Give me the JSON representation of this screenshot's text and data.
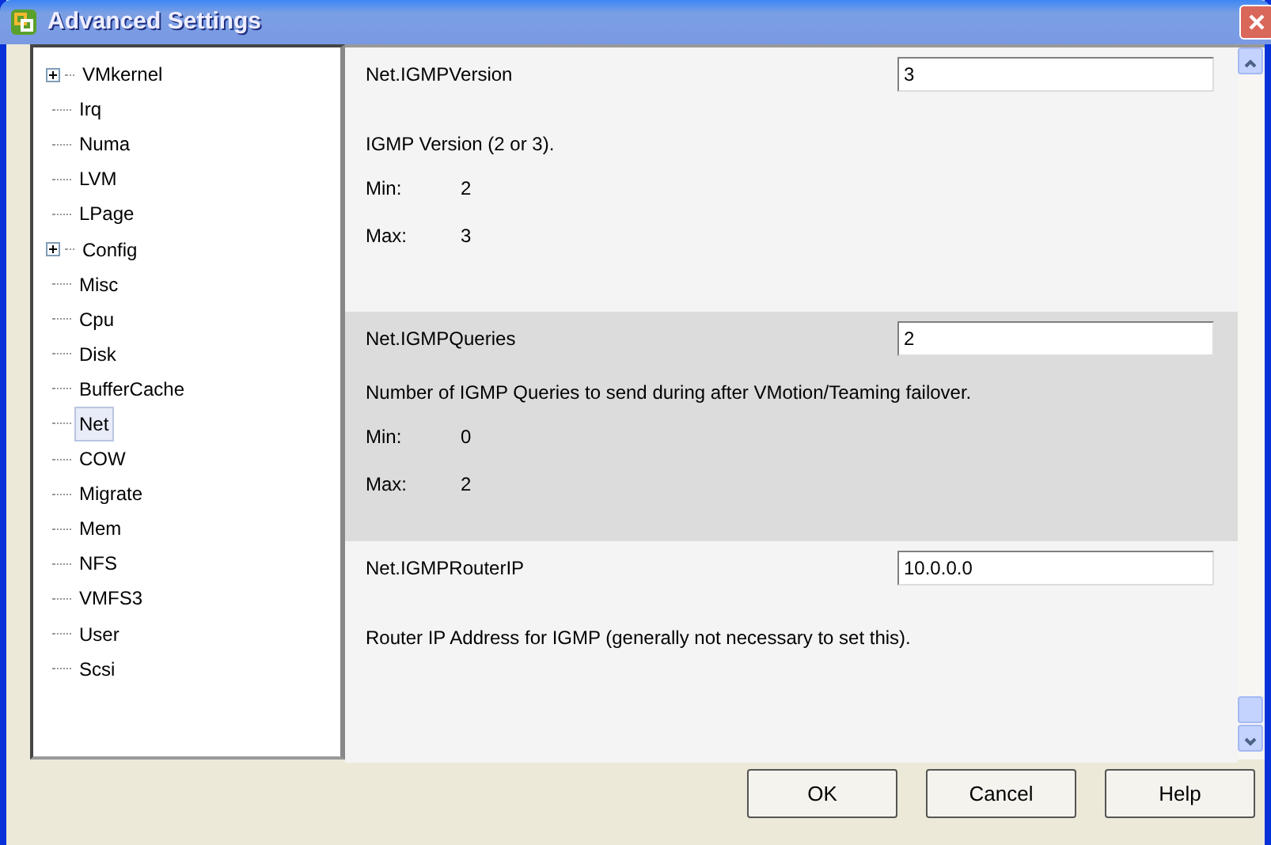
{
  "window": {
    "title": "Advanced Settings"
  },
  "tree": {
    "items": [
      {
        "label": "VMkernel",
        "kind": "group",
        "selected": false
      },
      {
        "label": "Irq",
        "kind": "leaf",
        "selected": false
      },
      {
        "label": "Numa",
        "kind": "leaf",
        "selected": false
      },
      {
        "label": "LVM",
        "kind": "leaf",
        "selected": false
      },
      {
        "label": "LPage",
        "kind": "leaf",
        "selected": false
      },
      {
        "label": "Config",
        "kind": "group",
        "selected": false
      },
      {
        "label": "Misc",
        "kind": "leaf",
        "selected": false
      },
      {
        "label": "Cpu",
        "kind": "leaf",
        "selected": false
      },
      {
        "label": "Disk",
        "kind": "leaf",
        "selected": false
      },
      {
        "label": "BufferCache",
        "kind": "leaf",
        "selected": false
      },
      {
        "label": "Net",
        "kind": "leaf",
        "selected": true
      },
      {
        "label": "COW",
        "kind": "leaf",
        "selected": false
      },
      {
        "label": "Migrate",
        "kind": "leaf",
        "selected": false
      },
      {
        "label": "Mem",
        "kind": "leaf",
        "selected": false
      },
      {
        "label": "NFS",
        "kind": "leaf",
        "selected": false
      },
      {
        "label": "VMFS3",
        "kind": "leaf",
        "selected": false
      },
      {
        "label": "User",
        "kind": "leaf",
        "selected": false
      },
      {
        "label": "Scsi",
        "kind": "leaf",
        "selected": false
      }
    ]
  },
  "settings": [
    {
      "name": "Net.IGMPVersion",
      "value": "3",
      "description": "IGMP Version (2 or 3).",
      "min_label": "Min:",
      "min": "2",
      "max_label": "Max:",
      "max": "3",
      "selected": false
    },
    {
      "name": "Net.IGMPQueries",
      "value": "2",
      "description": "Number of IGMP Queries to send during after VMotion/Teaming failover.",
      "min_label": "Min:",
      "min": "0",
      "max_label": "Max:",
      "max": "2",
      "selected": true
    },
    {
      "name": "Net.IGMPRouterIP",
      "value": "10.0.0.0",
      "description": "Router IP Address for IGMP (generally not necessary to set this).",
      "selected": false
    }
  ],
  "buttons": [
    "OK",
    "Cancel",
    "Help"
  ]
}
